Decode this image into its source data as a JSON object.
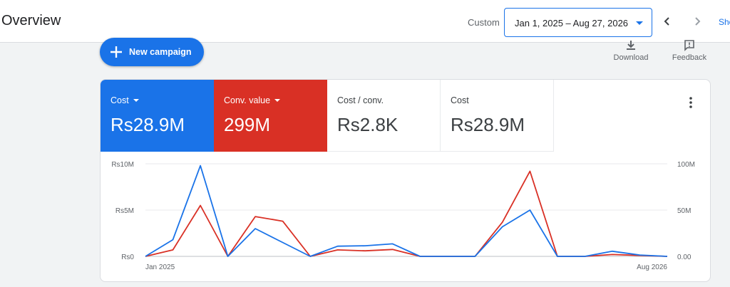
{
  "header": {
    "title": "Overview",
    "range_label": "Custom",
    "date_range": "Jan 1, 2025 – Aug 27, 2026",
    "show_link": "Sho"
  },
  "toolbar": {
    "new_campaign": "New campaign",
    "download": "Download",
    "feedback": "Feedback"
  },
  "metrics": [
    {
      "label": "Cost",
      "value": "Rs28.9M",
      "color": "#1a73e8"
    },
    {
      "label": "Conv. value",
      "value": "299M",
      "color": "#d93025"
    },
    {
      "label": "Cost / conv.",
      "value": "Rs2.8K"
    },
    {
      "label": "Cost",
      "value": "Rs28.9M"
    }
  ],
  "chart_data": {
    "type": "line",
    "x_tick_labels": [
      "Jan 2025",
      "Aug 2026"
    ],
    "y_left_ticks": [
      "Rs0",
      "Rs5M",
      "Rs10M"
    ],
    "y_right_ticks": [
      "0.00",
      "50M",
      "100M"
    ],
    "y_left_range": [
      0,
      10000000
    ],
    "y_right_range": [
      0,
      100000000
    ],
    "grid": true,
    "series": [
      {
        "color": "#1a73e8",
        "axis": "left",
        "values": [
          0,
          1800000,
          9800000,
          0,
          3000000,
          1500000,
          0,
          1100000,
          1150000,
          1350000,
          0,
          0,
          0,
          3200000,
          5000000,
          0,
          0,
          550000,
          150000,
          0
        ]
      },
      {
        "color": "#d93025",
        "axis": "right",
        "values": [
          0,
          7000000,
          55000000,
          0,
          43000000,
          38000000,
          0,
          7000000,
          6000000,
          7500000,
          0,
          0,
          0,
          37000000,
          92000000,
          0,
          0,
          2000000,
          1000000,
          0
        ]
      }
    ]
  }
}
